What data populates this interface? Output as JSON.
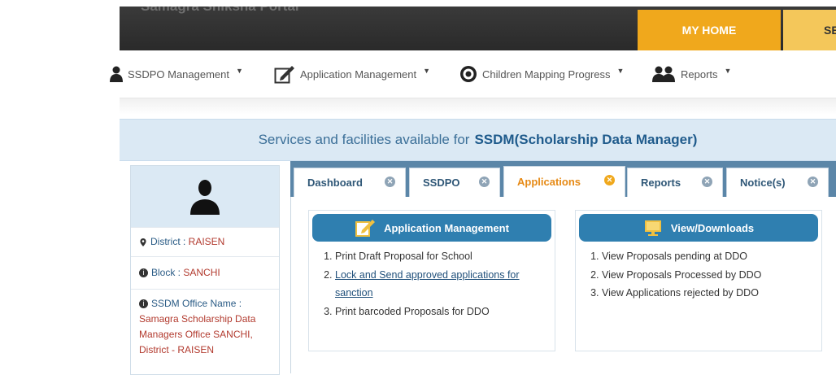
{
  "header": {
    "portal_title": "Samagra Shiksha Portal",
    "tabs": [
      {
        "label": "MY HOME"
      },
      {
        "label": "SE"
      }
    ]
  },
  "nav": {
    "items": [
      {
        "label": "SSDPO Management",
        "icon": "user-icon"
      },
      {
        "label": "Application Management",
        "icon": "edit-icon"
      },
      {
        "label": "Children Mapping Progress",
        "icon": "progress-icon"
      },
      {
        "label": "Reports",
        "icon": "users-icon"
      }
    ]
  },
  "banner": {
    "prefix": "Services and facilities available for",
    "role": "SSDM(Scholarship Data Manager)"
  },
  "profile": {
    "district_label": "District : ",
    "district_value": "RAISEN",
    "block_label": "Block : ",
    "block_value": "SANCHI",
    "office_label": "SSDM Office Name :",
    "office_value": "Samagra Scholarship Data Managers Office SANCHI, District - RAISEN"
  },
  "tabs": [
    {
      "label": "Dashboard",
      "active": false
    },
    {
      "label": "SSDPO",
      "active": false
    },
    {
      "label": "Applications",
      "active": true
    },
    {
      "label": "Reports",
      "active": false
    },
    {
      "label": "Notice(s)",
      "active": false
    }
  ],
  "cards": {
    "app_mgmt": {
      "title": "Application Management",
      "icon": "edit-note-icon",
      "items": [
        "Print Draft Proposal for School",
        "Lock and Send approved applications for sanction",
        "Print barcoded Proposals for DDO"
      ]
    },
    "view_downloads": {
      "title": "View/Downloads",
      "icon": "monitor-icon",
      "items": [
        "View Proposals pending at DDO",
        "View Proposals Processed by DDO",
        "View Applications rejected by DDO"
      ]
    }
  },
  "colors": {
    "accent_orange": "#f0a81c",
    "header_dark": "#2a2a2a",
    "banner_blue": "#dbe9f4",
    "card_head_blue": "#2f7fb0"
  }
}
